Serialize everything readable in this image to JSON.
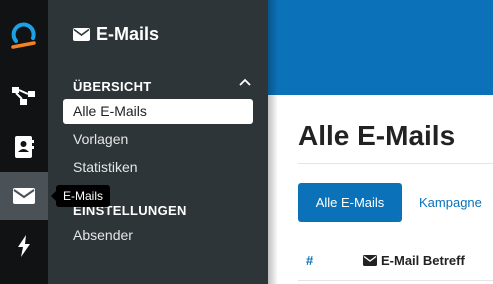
{
  "colors": {
    "rail_bg": "#101214",
    "rail_active_bg": "#4a5157",
    "subnav_bg": "#2e3538",
    "accent_blue": "#0b72b9",
    "logo_blue": "#1da1e6",
    "logo_orange": "#f58220"
  },
  "rail": {
    "items": [
      {
        "icon": "logo-icon"
      },
      {
        "icon": "workflow-icon"
      },
      {
        "icon": "contacts-icon"
      },
      {
        "icon": "envelope-icon",
        "active": true
      },
      {
        "icon": "lightning-icon"
      }
    ]
  },
  "tooltip": {
    "text": "E-Mails"
  },
  "subnav": {
    "title": "E-Mails",
    "sections": [
      {
        "heading": "ÜBERSICHT",
        "items": [
          {
            "label": "Alle E-Mails",
            "active": true
          },
          {
            "label": "Vorlagen"
          },
          {
            "label": "Statistiken"
          }
        ]
      },
      {
        "heading": "EINSTELLUNGEN",
        "items": [
          {
            "label": "Absender"
          }
        ]
      }
    ]
  },
  "main": {
    "page_title": "Alle E-Mails",
    "tabs": [
      {
        "label": "Alle E-Mails",
        "active": true
      },
      {
        "label": "Kampagne"
      }
    ],
    "table": {
      "columns": [
        "#",
        "E-Mail Betreff"
      ]
    }
  }
}
